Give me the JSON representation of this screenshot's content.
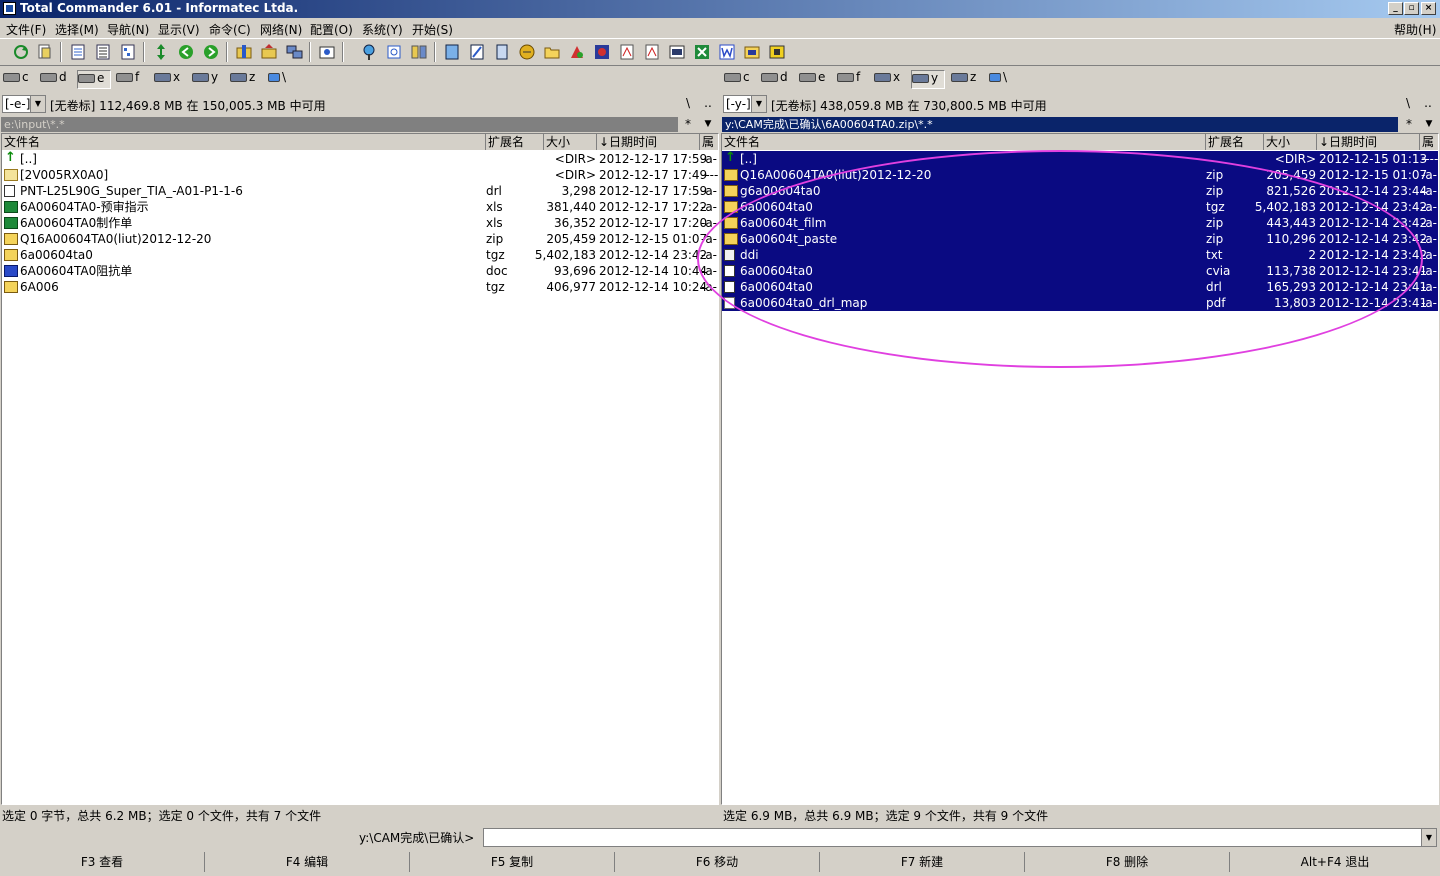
{
  "window": {
    "title": "Total Commander 6.01 - Informatec Ltda.",
    "min": "_",
    "max": "▫",
    "close": "×"
  },
  "menu": {
    "items": [
      "文件(F)",
      "选择(M)",
      "导航(N)",
      "显示(V)",
      "命令(C)",
      "网络(N)",
      "配置(O)",
      "系统(Y)",
      "开始(S)"
    ],
    "help": "帮助(H)"
  },
  "drives": {
    "left": [
      "c",
      "d",
      "e",
      "f",
      "x",
      "y",
      "z",
      "\\"
    ],
    "right": [
      "c",
      "d",
      "e",
      "f",
      "x",
      "y",
      "z",
      "\\"
    ],
    "left_active": "e",
    "right_active": "y"
  },
  "left": {
    "drive_combo": "[-e-]",
    "drive_info": "[无卷标]  112,469.8 MB 在 150,005.3 MB 中可用",
    "path": "e:\\input\\*.*",
    "root_btn": "\\",
    "up_btn": "..",
    "star_btn": "*",
    "hist_btn": "▼",
    "columns": [
      "文件名",
      "扩展名",
      "大小",
      "↓日期时间",
      "属"
    ],
    "files": [
      {
        "icon": "up-icon",
        "name": "[..]",
        "ext": "",
        "size": "<DIR>",
        "date": "2012-12-17 17:59",
        "attr": "-a-"
      },
      {
        "icon": "folder-icon",
        "name": "[2V005RX0A0]",
        "ext": "",
        "size": "<DIR>",
        "date": "2012-12-17 17:49",
        "attr": "----"
      },
      {
        "icon": "file-icon",
        "name": "PNT-L25L90G_Super_TIA_-A01-P1-1-6",
        "ext": "drl",
        "size": "3,298",
        "date": "2012-12-17 17:59",
        "attr": "-a-"
      },
      {
        "icon": "excel-icon",
        "name": "6A00604TA0-预审指示",
        "ext": "xls",
        "size": "381,440",
        "date": "2012-12-17 17:22",
        "attr": "-a-"
      },
      {
        "icon": "excel-icon",
        "name": "6A00604TA0制作单",
        "ext": "xls",
        "size": "36,352",
        "date": "2012-12-17 17:20",
        "attr": "-a-"
      },
      {
        "icon": "zip-icon",
        "name": "Q16A00604TA0(liut)2012-12-20",
        "ext": "zip",
        "size": "205,459",
        "date": "2012-12-15 01:07",
        "attr": "-a-"
      },
      {
        "icon": "zip-icon",
        "name": "6a00604ta0",
        "ext": "tgz",
        "size": "5,402,183",
        "date": "2012-12-14 23:42",
        "attr": "-a-"
      },
      {
        "icon": "word-icon",
        "name": "6A00604TA0阻抗单",
        "ext": "doc",
        "size": "93,696",
        "date": "2012-12-14 10:44",
        "attr": "-a-"
      },
      {
        "icon": "zip-icon",
        "name": "6A006",
        "ext": "tgz",
        "size": "406,977",
        "date": "2012-12-14 10:24",
        "attr": "-a-"
      }
    ],
    "status": "选定 0 字节，总共 6.2 MB；选定 0 个文件，共有 7 个文件"
  },
  "right": {
    "drive_combo": "[-y-]",
    "drive_info": "[无卷标]  438,059.8 MB 在 730,800.5 MB 中可用",
    "path": "y:\\CAM完成\\已确认\\6A00604TA0.zip\\*.*",
    "root_btn": "\\",
    "up_btn": "..",
    "star_btn": "*",
    "hist_btn": "▼",
    "columns": [
      "文件名",
      "扩展名",
      "大小",
      "↓日期时间",
      "属"
    ],
    "files": [
      {
        "icon": "up-icon",
        "name": "[..]",
        "ext": "",
        "size": "<DIR>",
        "date": "2012-12-15 01:13",
        "attr": "----"
      },
      {
        "icon": "zip-icon",
        "name": "Q16A00604TA0(liut)2012-12-20",
        "ext": "zip",
        "size": "205,459",
        "date": "2012-12-15 01:07",
        "attr": "-a-"
      },
      {
        "icon": "zip-icon",
        "name": "g6a00604ta0",
        "ext": "zip",
        "size": "821,526",
        "date": "2012-12-14 23:44",
        "attr": "-a-"
      },
      {
        "icon": "zip-icon",
        "name": "6a00604ta0",
        "ext": "tgz",
        "size": "5,402,183",
        "date": "2012-12-14 23:42",
        "attr": "-a-"
      },
      {
        "icon": "zip-icon",
        "name": "6a00604t_film",
        "ext": "zip",
        "size": "443,443",
        "date": "2012-12-14 23:42",
        "attr": "-a-"
      },
      {
        "icon": "zip-icon",
        "name": "6a00604t_paste",
        "ext": "zip",
        "size": "110,296",
        "date": "2012-12-14 23:42",
        "attr": "-a-"
      },
      {
        "icon": "text-file-icon",
        "name": "ddi",
        "ext": "txt",
        "size": "2",
        "date": "2012-12-14 23:42",
        "attr": "-a-"
      },
      {
        "icon": "file-icon",
        "name": "6a00604ta0",
        "ext": "cvia",
        "size": "113,738",
        "date": "2012-12-14 23:41",
        "attr": "-a-"
      },
      {
        "icon": "file-icon",
        "name": "6a00604ta0",
        "ext": "drl",
        "size": "165,293",
        "date": "2012-12-14 23:41",
        "attr": "-a-"
      },
      {
        "icon": "pdf-icon",
        "name": "6a00604ta0_drl_map",
        "ext": "pdf",
        "size": "13,803",
        "date": "2012-12-14 23:41",
        "attr": "-a-"
      }
    ],
    "status": "选定 6.9 MB，总共 6.9 MB；选定 9 个文件，共有 9 个文件"
  },
  "cmdline": {
    "label": "y:\\CAM完成\\已确认>",
    "value": ""
  },
  "fkeys": [
    "F3 查看",
    "F4 编辑",
    "F5 复制",
    "F6 移动",
    "F7 新建",
    "F8 删除",
    "Alt+F4 退出"
  ],
  "colors": {
    "selection": "#0a0a82",
    "highlight_ellipse": "#e040e0",
    "title_start": "#0a246a",
    "title_end": "#a6caf0"
  }
}
